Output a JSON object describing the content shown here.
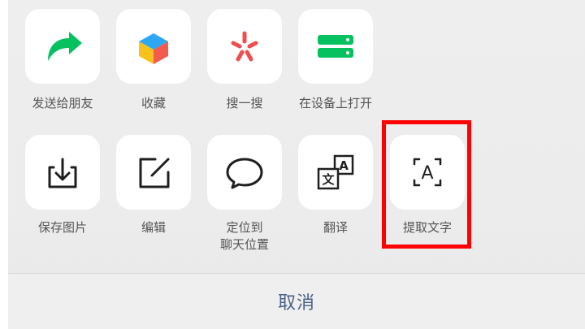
{
  "row1": [
    {
      "label": "发送给朋友",
      "icon": "share-arrow-icon"
    },
    {
      "label": "收藏",
      "icon": "favorite-cube-icon"
    },
    {
      "label": "搜一搜",
      "icon": "search-sparkle-icon"
    },
    {
      "label": "在设备上打开",
      "icon": "open-on-device-icon"
    }
  ],
  "row2": [
    {
      "label": "保存图片",
      "icon": "save-image-icon"
    },
    {
      "label": "编辑",
      "icon": "edit-icon"
    },
    {
      "label": "定位到\n聊天位置",
      "icon": "chat-bubble-icon"
    },
    {
      "label": "翻译",
      "icon": "translate-icon"
    },
    {
      "label": "提取文字",
      "icon": "extract-text-icon"
    }
  ],
  "cancel_label": "取消",
  "colors": {
    "share_green": "#07c160",
    "highlight_red": "#ff0000",
    "cancel_text": "#4c6185"
  }
}
